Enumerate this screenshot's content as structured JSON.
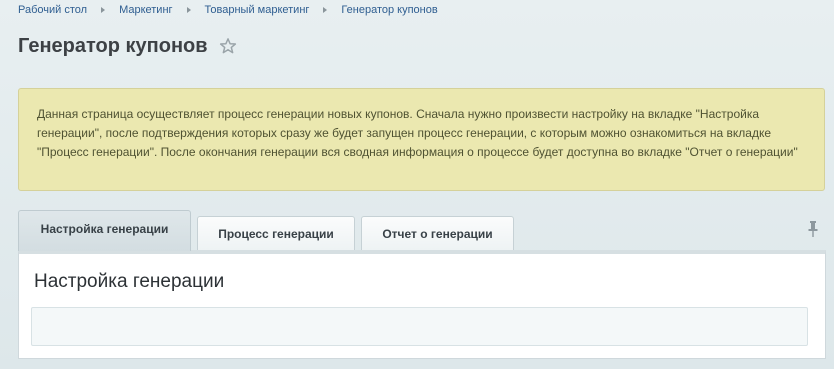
{
  "breadcrumb": {
    "items": [
      {
        "label": "Рабочий стол"
      },
      {
        "label": "Маркетинг"
      },
      {
        "label": "Товарный маркетинг"
      },
      {
        "label": "Генератор купонов"
      }
    ]
  },
  "header": {
    "title": "Генератор купонов",
    "favorite_icon": "star-icon"
  },
  "notice": {
    "text": "Данная страница осуществляет процесс генерации новых купонов. Сначала нужно произвести настройку на вкладке \"Настройка генерации\", после подтверждения которых сразу же будет запущен процесс генерации, с которым можно ознакомиться на вкладке \"Процесс генерации\". После окончания генерации вся сводная информация о процессе будет доступна во вкладке \"Отчет о генерации\""
  },
  "tabs": {
    "items": [
      {
        "label": "Настройка генерации",
        "active": true
      },
      {
        "label": "Процесс генерации",
        "active": false
      },
      {
        "label": "Отчет о генерации",
        "active": false
      }
    ],
    "pin_icon": "pin-icon"
  },
  "panel": {
    "title": "Настройка генерации"
  },
  "colors": {
    "link": "#2f5e91",
    "notice_background": "#ebe8b0",
    "notice_border": "#d5d19a",
    "page_background": "#e3ebee"
  }
}
